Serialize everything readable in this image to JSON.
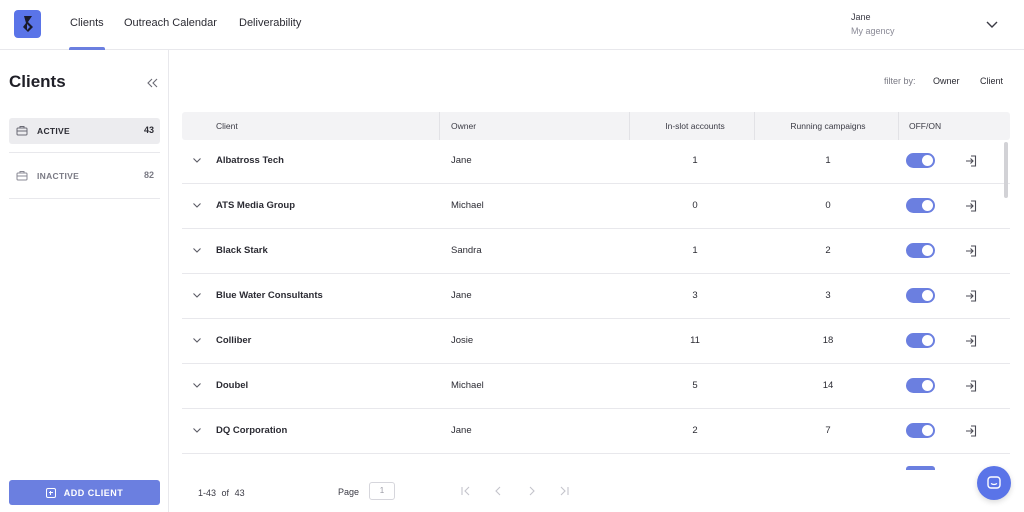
{
  "app": {
    "brand_color": "#5a74e8",
    "accent_color": "#6b7fe0"
  },
  "nav": {
    "tabs": [
      {
        "label": "Clients",
        "active": true
      },
      {
        "label": "Outreach Calendar",
        "active": false
      },
      {
        "label": "Deliverability",
        "active": false
      }
    ]
  },
  "user": {
    "name": "Jane",
    "agency": "My agency"
  },
  "sidebar": {
    "title": "Clients",
    "items": [
      {
        "label": "ACTIVE",
        "count": "43",
        "active": true
      },
      {
        "label": "INACTIVE",
        "count": "82",
        "active": false
      }
    ],
    "add_button": "ADD CLIENT"
  },
  "filter": {
    "label": "filter by:",
    "options": [
      "Owner",
      "Client"
    ]
  },
  "table": {
    "columns": [
      "Client",
      "Owner",
      "In-slot accounts",
      "Running campaigns",
      "OFF/ON"
    ],
    "rows": [
      {
        "client": "Albatross Tech",
        "owner": "Jane",
        "in_slot": "1",
        "running": "1",
        "on": true
      },
      {
        "client": "ATS Media Group",
        "owner": "Michael",
        "in_slot": "0",
        "running": "0",
        "on": true
      },
      {
        "client": "Black Stark",
        "owner": "Sandra",
        "in_slot": "1",
        "running": "2",
        "on": true
      },
      {
        "client": "Blue Water Consultants",
        "owner": "Jane",
        "in_slot": "3",
        "running": "3",
        "on": true
      },
      {
        "client": "Colliber",
        "owner": "Josie",
        "in_slot": "11",
        "running": "18",
        "on": true
      },
      {
        "client": "Doubel",
        "owner": "Michael",
        "in_slot": "5",
        "running": "14",
        "on": true
      },
      {
        "client": "DQ Corporation",
        "owner": "Jane",
        "in_slot": "2",
        "running": "7",
        "on": true
      }
    ]
  },
  "pagination": {
    "range": "1-43",
    "of_label": "of",
    "total": "43",
    "page_label": "Page",
    "page_value": "1"
  },
  "icons": [
    "logo-icon",
    "chevron-down-icon",
    "collapse-double-chevron-icon",
    "briefcase-icon",
    "login-arrow-icon",
    "first-page-icon",
    "prev-page-icon",
    "next-page-icon",
    "last-page-icon",
    "chat-icon"
  ]
}
